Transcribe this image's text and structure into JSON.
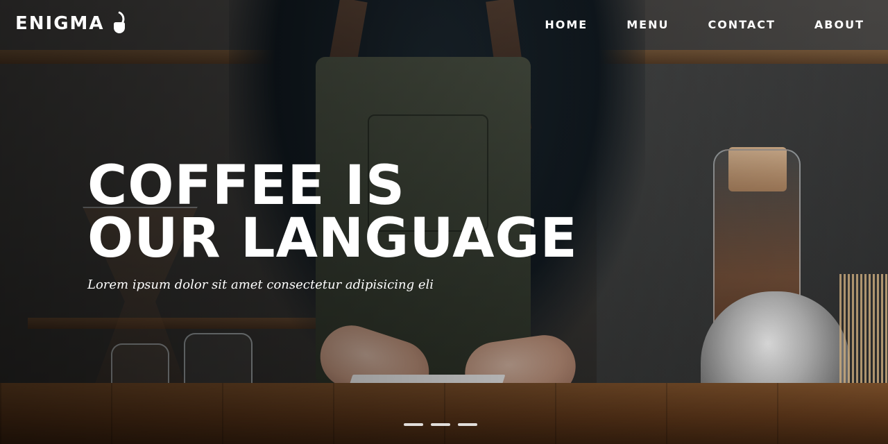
{
  "brand": {
    "name": "ENIGMA",
    "icon": "coffee-cup-icon"
  },
  "nav": {
    "items": [
      {
        "label": "HOME"
      },
      {
        "label": "MENU"
      },
      {
        "label": "CONTACT"
      },
      {
        "label": "ABOUT"
      }
    ]
  },
  "hero": {
    "headline_line1": "COFFEE IS",
    "headline_line2": "OUR LANGUAGE",
    "subtitle": "Lorem ipsum dolor sit amet consectetur adipisicing eli"
  },
  "carousel": {
    "slides": 3
  }
}
